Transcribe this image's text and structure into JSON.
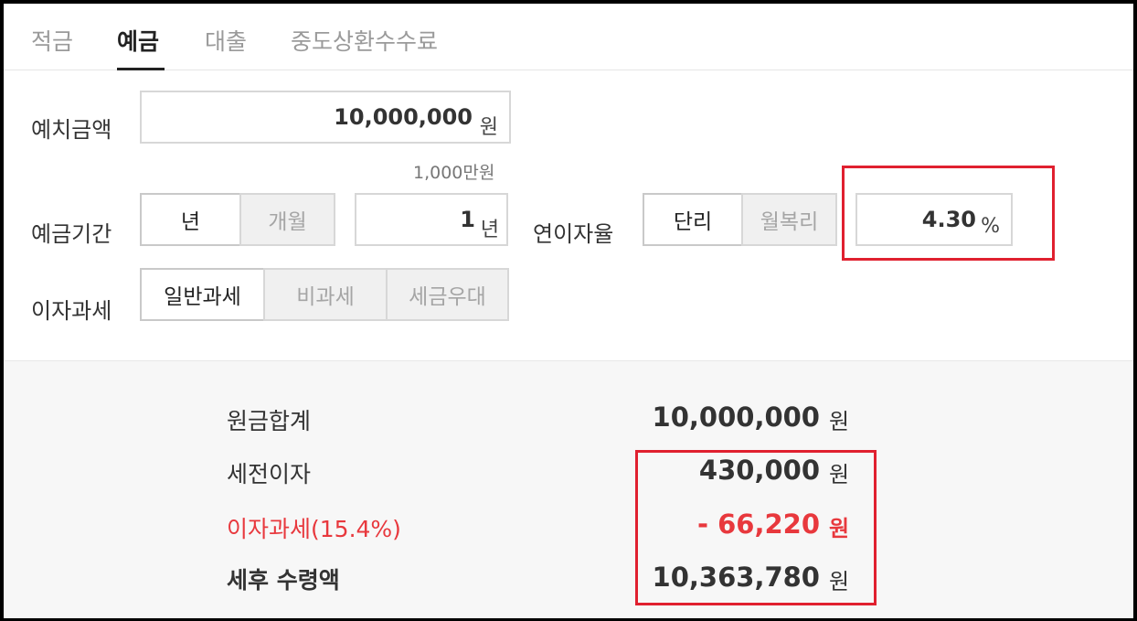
{
  "tabs": [
    "적금",
    "예금",
    "대출",
    "중도상환수수료"
  ],
  "form": {
    "deposit_label": "예치금액",
    "deposit_value": "10,000,000",
    "deposit_unit": "원",
    "deposit_hint": "1,000만원",
    "period_label": "예금기간",
    "period_options": [
      "년",
      "개월"
    ],
    "period_value": "1",
    "period_unit": "년",
    "rate_label": "연이자율",
    "rate_options": [
      "단리",
      "월복리"
    ],
    "rate_value": "4.30",
    "rate_unit": "%",
    "tax_label": "이자과세",
    "tax_options": [
      "일반과세",
      "비과세",
      "세금우대"
    ]
  },
  "results": {
    "principal_label": "원금합계",
    "principal_value": "10,000,000",
    "pretax_label": "세전이자",
    "pretax_value": "430,000",
    "tax_label": "이자과세(15.4%)",
    "tax_value": "- 66,220",
    "net_label": "세후 수령액",
    "net_value": "10,363,780",
    "unit": "원"
  },
  "colors": {
    "accent_red": "#e8383d",
    "highlight_box": "#e0202f"
  }
}
